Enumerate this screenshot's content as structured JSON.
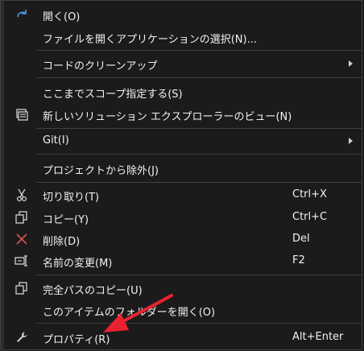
{
  "menu": {
    "items": [
      {
        "label": "開く(O)",
        "icon": "redo-arrow-icon"
      },
      {
        "label": "ファイルを開くアプリケーションの選択(N)..."
      },
      {
        "label": "コードのクリーンアップ",
        "has_submenu": true
      },
      {
        "label": "ここまでスコープ指定する(S)"
      },
      {
        "label": "新しいソリューション エクスプローラーのビュー(N)",
        "icon": "solution-explorer-view-icon"
      },
      {
        "label": "Git(I)",
        "has_submenu": true
      },
      {
        "label": "プロジェクトから除外(J)"
      },
      {
        "label": "切り取り(T)",
        "shortcut": "Ctrl+X",
        "icon": "cut-icon"
      },
      {
        "label": "コピー(Y)",
        "shortcut": "Ctrl+C",
        "icon": "copy-icon"
      },
      {
        "label": "削除(D)",
        "shortcut": "Del",
        "icon": "delete-icon"
      },
      {
        "label": "名前の変更(M)",
        "shortcut": "F2",
        "icon": "rename-icon"
      },
      {
        "label": "完全パスのコピー(U)",
        "icon": "copy-path-icon"
      },
      {
        "label": "このアイテムのフォルダーを開く(O)"
      },
      {
        "label": "プロパティ(R)",
        "shortcut": "Alt+Enter",
        "icon": "wrench-icon"
      }
    ]
  },
  "colors": {
    "menu_background": "#1b1b1c",
    "text": "#f1f1f1",
    "separator": "#3f3f46",
    "icon_blue": "#4e9cde",
    "delete_red": "#e05252",
    "annotation_arrow": "#e8232f"
  }
}
